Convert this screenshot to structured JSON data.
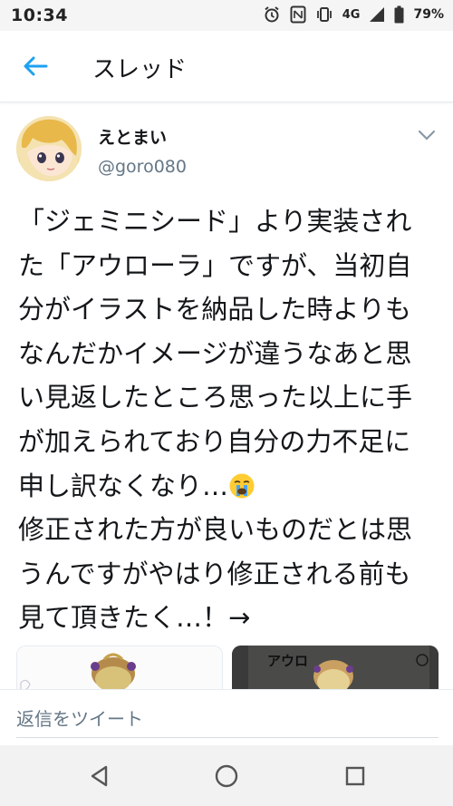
{
  "status_bar": {
    "time": "10:34",
    "network": "4G",
    "battery": "79%",
    "icons": [
      "alarm-icon",
      "nfc-icon",
      "vibrate-icon",
      "signal-icon",
      "battery-icon"
    ]
  },
  "header": {
    "title": "スレッド",
    "back_icon": "back-arrow-icon",
    "accent_color": "#1da1f2"
  },
  "tweet": {
    "author": {
      "name": "えとまい",
      "handle": "@goro080"
    },
    "text_lines": [
      "「ジェミニシード」より実装され",
      "た「アウローラ」ですが、当初自",
      "分がイラストを納品した時よりも",
      "なんだかイメージが違うなあと思",
      "い見返したところ思った以上に手",
      "が加えられており自分の力不足に",
      "申し訳なくなり…",
      "修正された方が良いものだとは思",
      "うんですがやはり修正される前も",
      "見て頂きたく…！→"
    ],
    "emoji": "crying-face-icon",
    "media": [
      {
        "name": "illustration-original"
      },
      {
        "name": "illustration-modified",
        "caption": "アウロ"
      }
    ]
  },
  "reply": {
    "placeholder": "返信をツイート"
  },
  "nav_bar": {
    "buttons": [
      "back-triangle-icon",
      "home-circle-icon",
      "recents-square-icon"
    ]
  }
}
